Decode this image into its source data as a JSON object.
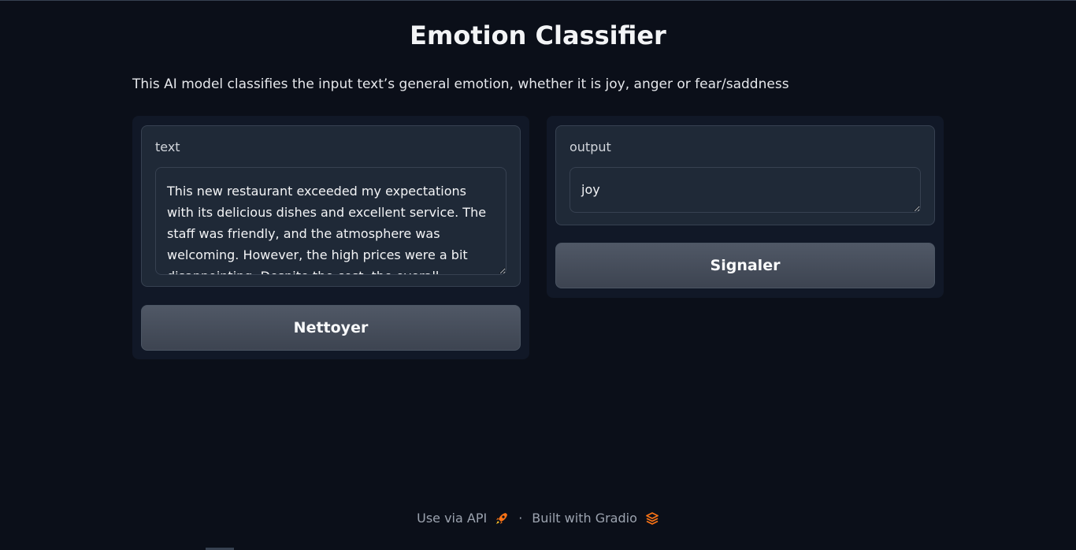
{
  "app": {
    "title": "Emotion Classifier",
    "description": "This AI model classifies the input text’s general emotion, whether it is joy, anger or fear/saddness"
  },
  "input": {
    "label": "text",
    "value": "This new restaurant exceeded my expectations with its delicious dishes and excellent service. The staff was friendly, and the atmosphere was welcoming. However, the high prices were a bit disappointing. Despite the cost, the overall"
  },
  "output": {
    "label": "output",
    "value": "joy"
  },
  "buttons": {
    "clear_label": "Nettoyer",
    "flag_label": "Signaler"
  },
  "footer": {
    "api_label": "Use via API",
    "separator": "·",
    "built_label": "Built with Gradio"
  },
  "colors": {
    "background": "#0b0f19",
    "panel": "#111827",
    "block": "#1f2937",
    "accent": "#f97316"
  },
  "icons": {
    "api": "rocket-icon",
    "gradio": "gradio-logo-icon"
  }
}
